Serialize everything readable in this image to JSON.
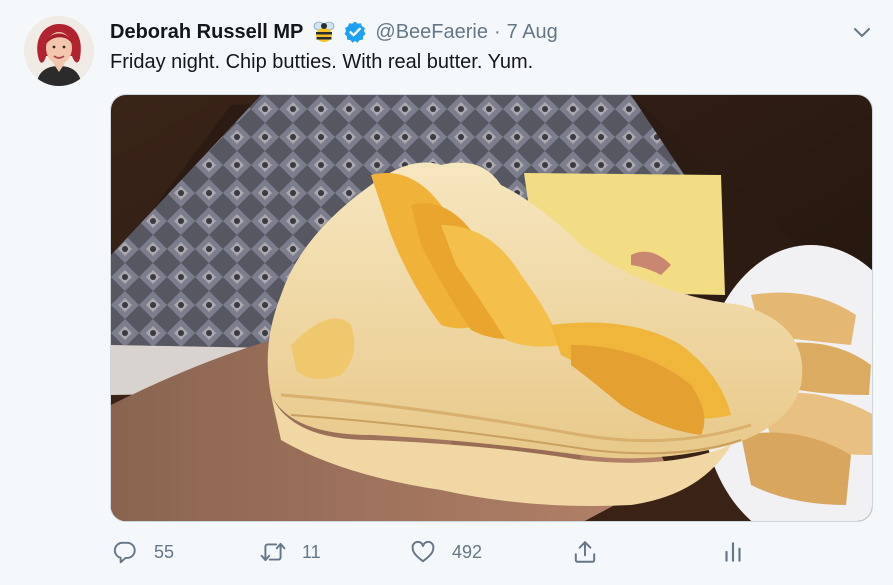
{
  "author": {
    "name": "Deborah Russell MP",
    "handle": "@BeeFaerie",
    "separator": "·",
    "date": "7 Aug"
  },
  "tweet": {
    "text": "Friday night. Chip butties. With real butter. Yum."
  },
  "actions": {
    "reply_count": "55",
    "retweet_count": "11",
    "like_count": "492"
  },
  "colors": {
    "text": "#14171a",
    "secondary": "#657786",
    "verified": "#1da1f2",
    "background": "#f5f8fa"
  },
  "icons": {
    "menu": "chevron-down-icon",
    "verified": "verified-badge-icon",
    "emoji": "bee-emoji-icon",
    "reply": "reply-icon",
    "retweet": "retweet-icon",
    "like": "heart-icon",
    "share": "share-icon",
    "analytics": "analytics-icon"
  }
}
